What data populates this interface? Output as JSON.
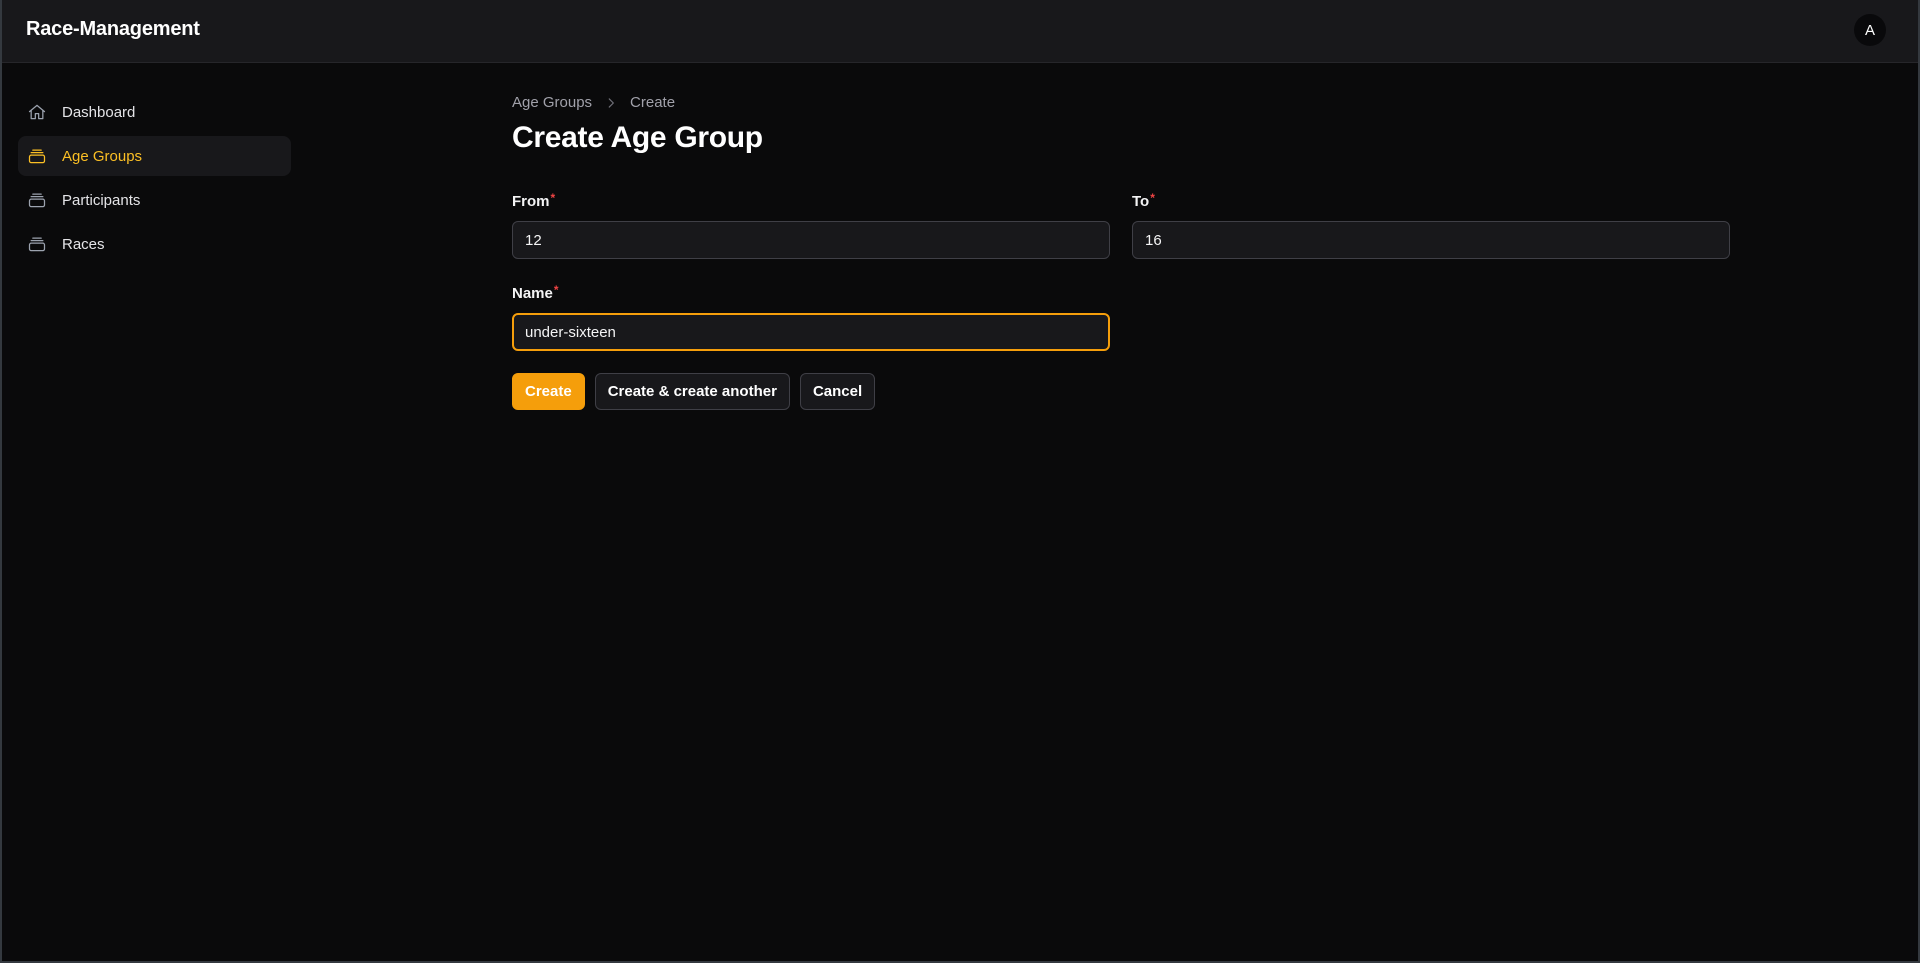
{
  "app": {
    "title": "Race-Management",
    "user_initial": "A"
  },
  "sidebar": {
    "items": [
      {
        "label": "Dashboard",
        "icon": "home-icon",
        "active": false
      },
      {
        "label": "Age Groups",
        "icon": "stack-icon",
        "active": true
      },
      {
        "label": "Participants",
        "icon": "stack-icon",
        "active": false
      },
      {
        "label": "Races",
        "icon": "stack-icon",
        "active": false
      }
    ]
  },
  "breadcrumb": {
    "parent": "Age Groups",
    "current": "Create"
  },
  "page": {
    "title": "Create Age Group"
  },
  "form": {
    "from": {
      "label": "From",
      "required_mark": "*",
      "value": "12"
    },
    "to": {
      "label": "To",
      "required_mark": "*",
      "value": "16"
    },
    "name": {
      "label": "Name",
      "required_mark": "*",
      "value": "under-sixteen"
    }
  },
  "actions": {
    "create": "Create",
    "create_another": "Create & create another",
    "cancel": "Cancel"
  },
  "colors": {
    "accent": "#f59e0b",
    "active_nav_text": "#fbbf24",
    "required": "#ef4444"
  }
}
